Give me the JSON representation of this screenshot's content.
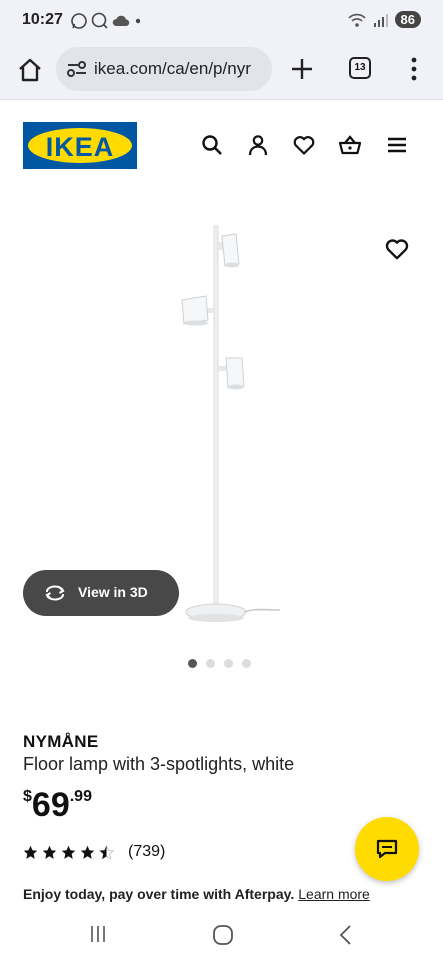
{
  "status_bar": {
    "time": "10:27",
    "battery": "86",
    "left_icons": [
      "whatsapp-icon",
      "messenger-icon",
      "cloud-icon",
      "dot-icon"
    ],
    "right_icons": [
      "wifi-icon",
      "signal-icon",
      "battery-icon"
    ]
  },
  "browser": {
    "url": "ikea.com/ca/en/p/nyr",
    "tab_count": "13"
  },
  "header": {
    "logo_text": "IKEA",
    "icons": [
      "search-icon",
      "profile-icon",
      "heart-icon",
      "basket-icon",
      "menu-icon"
    ],
    "brand_blue": "#0058a3",
    "brand_yellow": "#ffdb00"
  },
  "gallery": {
    "view3d_label": "View in 3D",
    "page_count": 4,
    "active_index": 0
  },
  "product": {
    "name": "NYMÅNE",
    "description": "Floor lamp with 3-spotlights, white",
    "price_currency": "$",
    "price_int": "69",
    "price_dec": ".99",
    "rating_value": 4.5,
    "review_count": "(739)"
  },
  "afterpay": {
    "text": "Enjoy today, pay over time with Afterpay.",
    "link": "Learn more"
  }
}
